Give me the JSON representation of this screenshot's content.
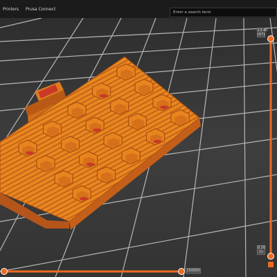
{
  "topbar": {
    "tabs": [
      "Printers",
      "Prusa Connect"
    ],
    "search_placeholder": "Enter a search term"
  },
  "vertical_slider": {
    "top_value": "13.40",
    "top_sub": "(67)",
    "bottom_value": "0.20",
    "bottom_sub": "(1)"
  },
  "horizontal_slider": {
    "value": "150000"
  },
  "colors": {
    "model_orange": "#e07a1f",
    "slider_orange": "#ed6b21",
    "infill_red": "#c83a26",
    "bed_gray": "#3c3c3c"
  }
}
